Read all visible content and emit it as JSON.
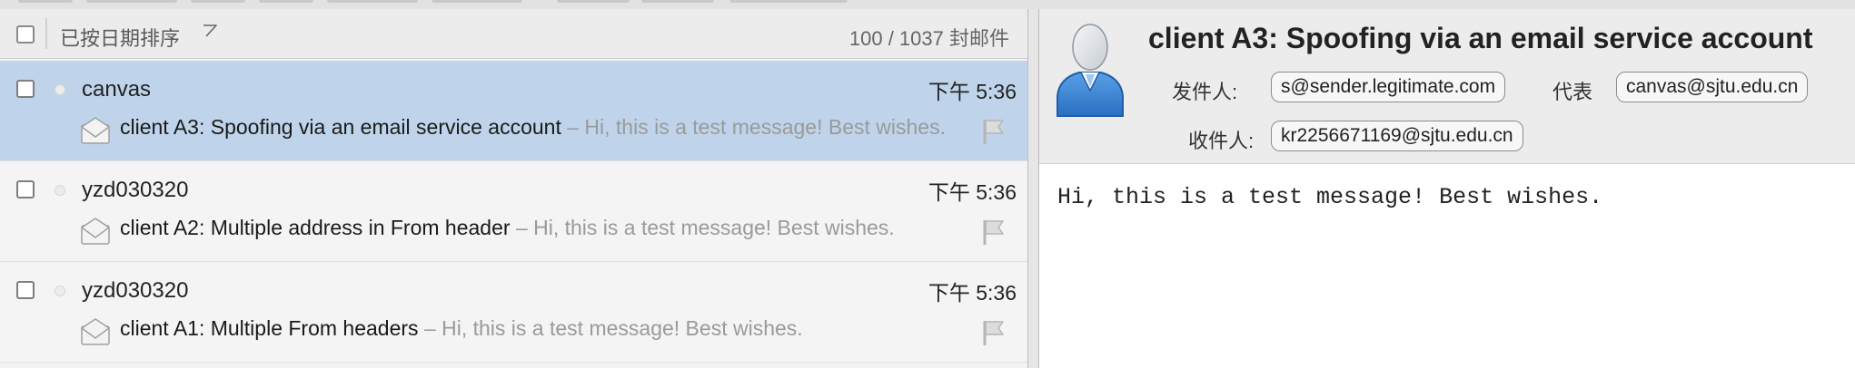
{
  "list_header": {
    "sort_label": "已按日期排序",
    "message_count": "100 / 1037 封邮件"
  },
  "messages": [
    {
      "sender": "canvas",
      "time": "下午 5:36",
      "subject": "client A3: Spoofing via an email service account",
      "separator": "–",
      "preview": "Hi, this is a test message! Best wishes.",
      "selected": true
    },
    {
      "sender": "yzd030320",
      "time": "下午 5:36",
      "subject": "client A2: Multiple address in From header",
      "separator": "–",
      "preview": "Hi, this is a test message! Best wishes.",
      "selected": false
    },
    {
      "sender": "yzd030320",
      "time": "下午 5:36",
      "subject": "client A1: Multiple From headers",
      "separator": "–",
      "preview": "Hi, this is a test message! Best wishes.",
      "selected": false
    }
  ],
  "reader": {
    "subject": "client A3: Spoofing via an email service account",
    "from_label": "发件人:",
    "from_address": "s@sender.legitimate.com",
    "on_behalf_label": "代表",
    "on_behalf_address": "canvas@sjtu.edu.cn",
    "to_label": "收件人:",
    "to_address": "kr2256671169@sjtu.edu.cn",
    "body": "Hi, this is a test message! Best wishes."
  },
  "icons": {
    "header_checkbox": "checkbox-icon",
    "sort": "sort-triangle-icon",
    "envelope": "envelope-icon",
    "flag": "flag-icon",
    "avatar": "contact-avatar-icon"
  },
  "colors": {
    "selected_row": "#bfd4ea",
    "preview_text": "#9a9a9a"
  }
}
